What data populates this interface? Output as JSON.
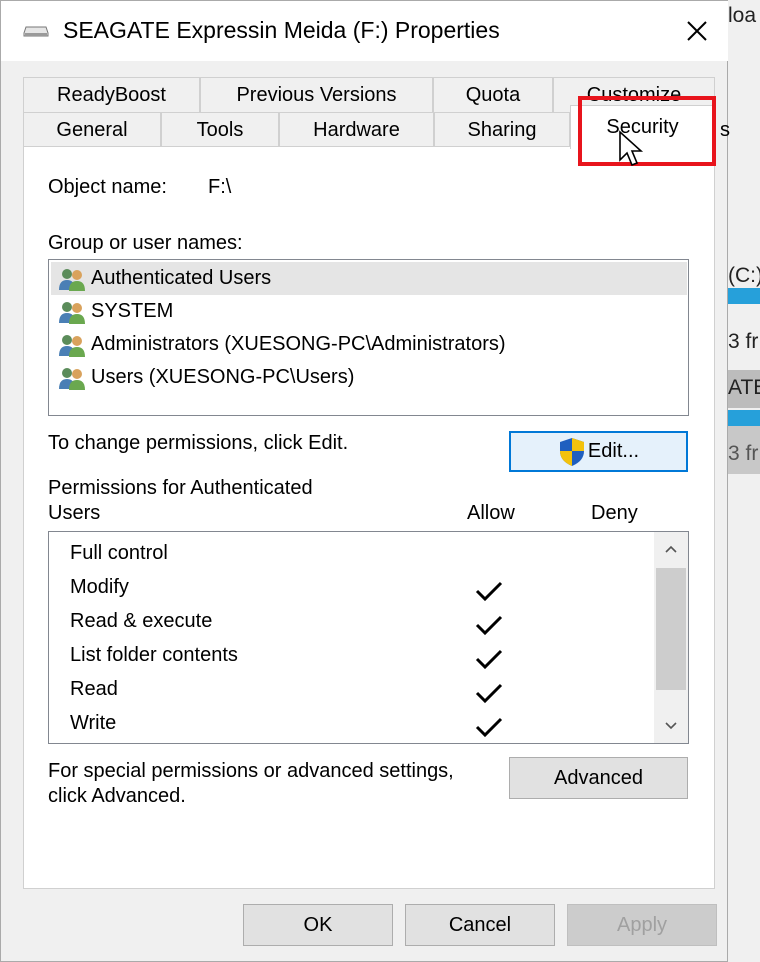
{
  "window": {
    "title": "SEAGATE Expressin Meida (F:) Properties",
    "close_label": "✕"
  },
  "background_window": {
    "text_top": "loa",
    "drive_label": "(C:)",
    "free_text_1": "3 fr",
    "seagate_fragment": "ATE",
    "free_text_2": "3 fr"
  },
  "tabs": {
    "row_top": [
      "ReadyBoost",
      "Previous Versions",
      "Quota",
      "Customize"
    ],
    "row_bottom": [
      "General",
      "Tools",
      "Hardware",
      "Sharing",
      "Security"
    ],
    "active": "Security",
    "partial_hidden": "s"
  },
  "security": {
    "object_name_label": "Object name:",
    "object_name_value": "F:\\",
    "group_label": "Group or user names:",
    "users": [
      "Authenticated Users",
      "SYSTEM",
      "Administrators (XUESONG-PC\\Administrators)",
      "Users (XUESONG-PC\\Users)"
    ],
    "selected_user_index": 0,
    "change_text": "To change permissions, click Edit.",
    "edit_button": "Edit...",
    "permissions_label_line1": "Permissions for Authenticated",
    "permissions_label_line2": "Users",
    "allow_header": "Allow",
    "deny_header": "Deny",
    "permissions": [
      {
        "name": "Full control",
        "allow": false,
        "deny": false
      },
      {
        "name": "Modify",
        "allow": true,
        "deny": false
      },
      {
        "name": "Read & execute",
        "allow": true,
        "deny": false
      },
      {
        "name": "List folder contents",
        "allow": true,
        "deny": false
      },
      {
        "name": "Read",
        "allow": true,
        "deny": false
      },
      {
        "name": "Write",
        "allow": true,
        "deny": false
      }
    ],
    "advanced_text_line1": "For special permissions or advanced settings,",
    "advanced_text_line2": "click Advanced.",
    "advanced_button": "Advanced"
  },
  "footer": {
    "ok": "OK",
    "cancel": "Cancel",
    "apply": "Apply"
  },
  "colors": {
    "highlight_box": "#e8141c",
    "focus_border": "#0078d7"
  }
}
